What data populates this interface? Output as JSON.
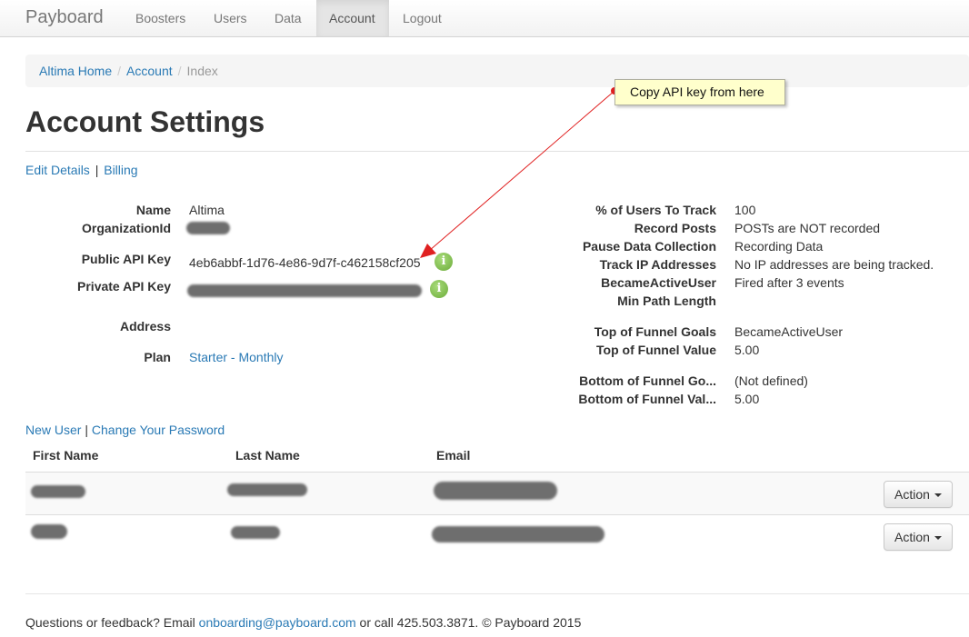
{
  "navbar": {
    "brand": "Payboard",
    "items": [
      "Boosters",
      "Users",
      "Data",
      "Account",
      "Logout"
    ],
    "active": "Account"
  },
  "breadcrumb": {
    "home": "Altima Home",
    "section": "Account",
    "current": "Index",
    "separator": "/"
  },
  "callout": {
    "text": "Copy API key from here"
  },
  "page": {
    "title": "Account Settings",
    "edit_details": "Edit Details",
    "billing": "Billing",
    "pipe": "|"
  },
  "details": {
    "name_label": "Name",
    "name_value": "Altima",
    "org_label": "OrganizationId",
    "public_key_label": "Public API Key",
    "public_key_value": "4eb6abbf-1d76-4e86-9d7f-c462158cf205",
    "private_key_label": "Private API Key",
    "address_label": "Address",
    "plan_label": "Plan",
    "plan_value": "Starter - Monthly",
    "info_glyph": "i"
  },
  "settings": [
    {
      "label": "% of Users To Track",
      "value": "100"
    },
    {
      "label": "Record Posts",
      "value": "POSTs are NOT recorded"
    },
    {
      "label": "Pause Data Collection",
      "value": "Recording Data"
    },
    {
      "label": "Track IP Addresses",
      "value": "No IP addresses are being tracked."
    },
    {
      "label": "BecameActiveUser",
      "value": "Fired after 3 events"
    },
    {
      "label": "Min Path Length",
      "value": ""
    },
    {
      "label": "Top of Funnel Goals",
      "value": "BecameActiveUser"
    },
    {
      "label": "Top of Funnel Value",
      "value": "5.00"
    },
    {
      "label": "Bottom of Funnel Go...",
      "value": "(Not defined)"
    },
    {
      "label": "Bottom of Funnel Val...",
      "value": "5.00"
    }
  ],
  "users": {
    "new_user": "New User",
    "change_password": "Change Your Password",
    "columns": [
      "First Name",
      "Last Name",
      "Email"
    ],
    "action_label": "Action"
  },
  "footer": {
    "prefix": "Questions or feedback? Email",
    "email": "onboarding@payboard.com",
    "suffix": "or call 425.503.3871. © Payboard 2015"
  },
  "colors": {
    "link": "#2a7ab5",
    "callout_bg": "#ffffcc",
    "arrow": "#e02020",
    "info_icon": "#6cab3a"
  }
}
